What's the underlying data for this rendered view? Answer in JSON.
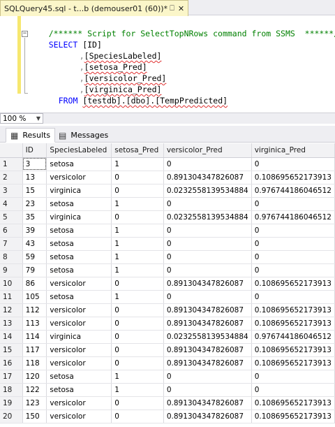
{
  "tab": {
    "title": "SQLQuery45.sql - t...b (demouser01 (60))*",
    "pin_icon": "pin-icon",
    "close_icon": "close-icon"
  },
  "editor": {
    "comment": "/****** Script for SelectTopNRows command from SSMS  ******/",
    "select_kw": "SELECT",
    "col1": "[ID]",
    "col2": "[SpeciesLabeled]",
    "col3": "[setosa_Pred]",
    "col4": "[versicolor_Pred]",
    "col5": "[virginica_Pred]",
    "from_kw": "FROM",
    "table": "[testdb].[dbo].[TempPredicted]",
    "comma": ","
  },
  "zoom": {
    "value": "100 %"
  },
  "result_tabs": [
    {
      "label": "Results",
      "icon": "grid-icon"
    },
    {
      "label": "Messages",
      "icon": "messages-icon"
    }
  ],
  "grid": {
    "columns": [
      "",
      "ID",
      "SpeciesLabeled",
      "setosa_Pred",
      "versicolor_Pred",
      "virginica_Pred"
    ],
    "rows": [
      [
        "1",
        "3",
        "setosa",
        "1",
        "0",
        "0"
      ],
      [
        "2",
        "13",
        "versicolor",
        "0",
        "0.891304347826087",
        "0.108695652173913"
      ],
      [
        "3",
        "15",
        "virginica",
        "0",
        "0.0232558139534884",
        "0.976744186046512"
      ],
      [
        "4",
        "23",
        "setosa",
        "1",
        "0",
        "0"
      ],
      [
        "5",
        "35",
        "virginica",
        "0",
        "0.0232558139534884",
        "0.976744186046512"
      ],
      [
        "6",
        "39",
        "setosa",
        "1",
        "0",
        "0"
      ],
      [
        "7",
        "43",
        "setosa",
        "1",
        "0",
        "0"
      ],
      [
        "8",
        "59",
        "setosa",
        "1",
        "0",
        "0"
      ],
      [
        "9",
        "79",
        "setosa",
        "1",
        "0",
        "0"
      ],
      [
        "10",
        "86",
        "versicolor",
        "0",
        "0.891304347826087",
        "0.108695652173913"
      ],
      [
        "11",
        "105",
        "setosa",
        "1",
        "0",
        "0"
      ],
      [
        "12",
        "112",
        "versicolor",
        "0",
        "0.891304347826087",
        "0.108695652173913"
      ],
      [
        "13",
        "113",
        "versicolor",
        "0",
        "0.891304347826087",
        "0.108695652173913"
      ],
      [
        "14",
        "114",
        "virginica",
        "0",
        "0.0232558139534884",
        "0.976744186046512"
      ],
      [
        "15",
        "117",
        "versicolor",
        "0",
        "0.891304347826087",
        "0.108695652173913"
      ],
      [
        "16",
        "118",
        "versicolor",
        "0",
        "0.891304347826087",
        "0.108695652173913"
      ],
      [
        "17",
        "120",
        "setosa",
        "1",
        "0",
        "0"
      ],
      [
        "18",
        "122",
        "setosa",
        "1",
        "0",
        "0"
      ],
      [
        "19",
        "123",
        "versicolor",
        "0",
        "0.891304347826087",
        "0.108695652173913"
      ],
      [
        "20",
        "150",
        "versicolor",
        "0",
        "0.891304347826087",
        "0.108695652173913"
      ]
    ]
  }
}
